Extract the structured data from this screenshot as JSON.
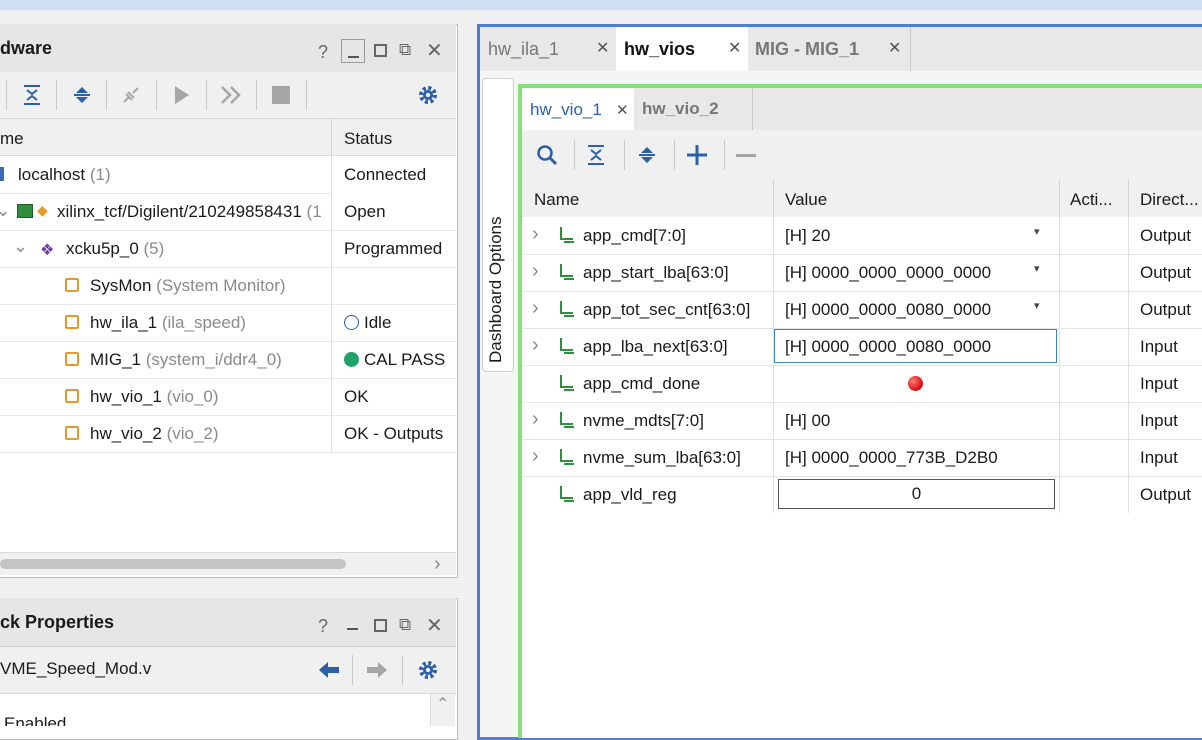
{
  "hardware": {
    "title": "dware",
    "columns": {
      "name": "me",
      "status": "Status"
    },
    "rows": [
      {
        "name": "localhost",
        "suffix": "(1)",
        "status": "Connected"
      },
      {
        "name": "xilinx_tcf/Digilent/210249858431",
        "suffix": "(1",
        "status": "Open"
      },
      {
        "name": "xcku5p_0",
        "suffix": "(5)",
        "status": "Programmed"
      },
      {
        "name": "SysMon",
        "suffix": "(System Monitor)",
        "status": ""
      },
      {
        "name": "hw_ila_1",
        "suffix": "(ila_speed)",
        "status": "Idle"
      },
      {
        "name": "MIG_1",
        "suffix": "(system_i/ddr4_0)",
        "status": "CAL PASS"
      },
      {
        "name": "hw_vio_1",
        "suffix": "(vio_0)",
        "status": "OK"
      },
      {
        "name": "hw_vio_2",
        "suffix": "(vio_2)",
        "status": "OK - Outputs"
      }
    ],
    "status_colors": {
      "idle_ring": "#2b5fa8",
      "cal_pass": "#1fa36a"
    }
  },
  "properties": {
    "title": "ck Properties",
    "file": "VME_Speed_Mod.v",
    "partial_row": "Enabled"
  },
  "dashboard": {
    "tabs": [
      {
        "label": "hw_ila_1"
      },
      {
        "label": "hw_vios"
      },
      {
        "label": "MIG - MIG_1"
      }
    ],
    "side_label": "Dashboard Options",
    "inner_tabs": [
      {
        "label": "hw_vio_1"
      },
      {
        "label": "hw_vio_2"
      }
    ],
    "columns": {
      "name": "Name",
      "value": "Value",
      "activity": "Acti...",
      "direction": "Direct..."
    },
    "rows": [
      {
        "name": "app_cmd[7:0]",
        "value": "[H] 20",
        "direction": "Output"
      },
      {
        "name": "app_start_lba[63:0]",
        "value": "[H] 0000_0000_0000_0000",
        "direction": "Output"
      },
      {
        "name": "app_tot_sec_cnt[63:0]",
        "value": "[H] 0000_0000_0080_0000",
        "direction": "Output"
      },
      {
        "name": "app_lba_next[63:0]",
        "value": "[H] 0000_0000_0080_0000",
        "direction": "Input"
      },
      {
        "name": "app_cmd_done",
        "value": "",
        "direction": "Input"
      },
      {
        "name": "nvme_mdts[7:0]",
        "value": "[H] 00",
        "direction": "Input"
      },
      {
        "name": "nvme_sum_lba[63:0]",
        "value": "[H] 0000_0000_773B_D2B0",
        "direction": "Input"
      },
      {
        "name": "app_vld_reg",
        "value": "0",
        "direction": "Output"
      }
    ],
    "led_color": "#e01818"
  }
}
